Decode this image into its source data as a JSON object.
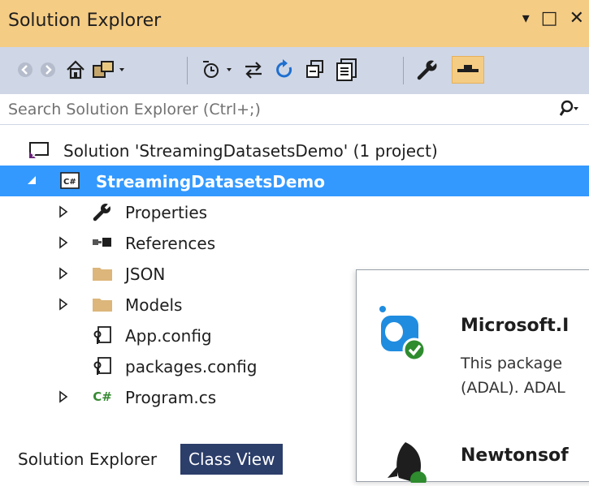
{
  "panel": {
    "title": "Solution Explorer",
    "controls": {
      "dropdown": "▾",
      "maximize": "□",
      "close": "✕"
    }
  },
  "toolbar": {
    "buttons": [
      "back",
      "forward",
      "home",
      "switch-views",
      "pending-changes-filter",
      "sync-with-document",
      "refresh",
      "collapse-all",
      "show-all-files",
      "properties",
      "preview-selected-items"
    ]
  },
  "search": {
    "placeholder": "Search Solution Explorer (Ctrl+;)"
  },
  "tree": {
    "solution": "Solution 'StreamingDatasetsDemo' (1 project)",
    "project": "StreamingDatasetsDemo",
    "items": [
      "Properties",
      "References",
      "JSON",
      "Models",
      "App.config",
      "packages.config",
      "Program.cs"
    ],
    "csharp_badge": "C#"
  },
  "tabs": {
    "active": "Solution Explorer",
    "inactive": "Class View"
  },
  "popup": {
    "package1": {
      "title": "Microsoft.I",
      "desc_line1": "This package",
      "desc_line2": "(ADAL). ADAL"
    },
    "package2": {
      "title": "Newtonsof"
    }
  },
  "colors": {
    "title_bar": "#f5cc84",
    "toolbar": "#cfd6e5",
    "selection": "#3399ff",
    "class_view_tab": "#2c3e6a"
  }
}
